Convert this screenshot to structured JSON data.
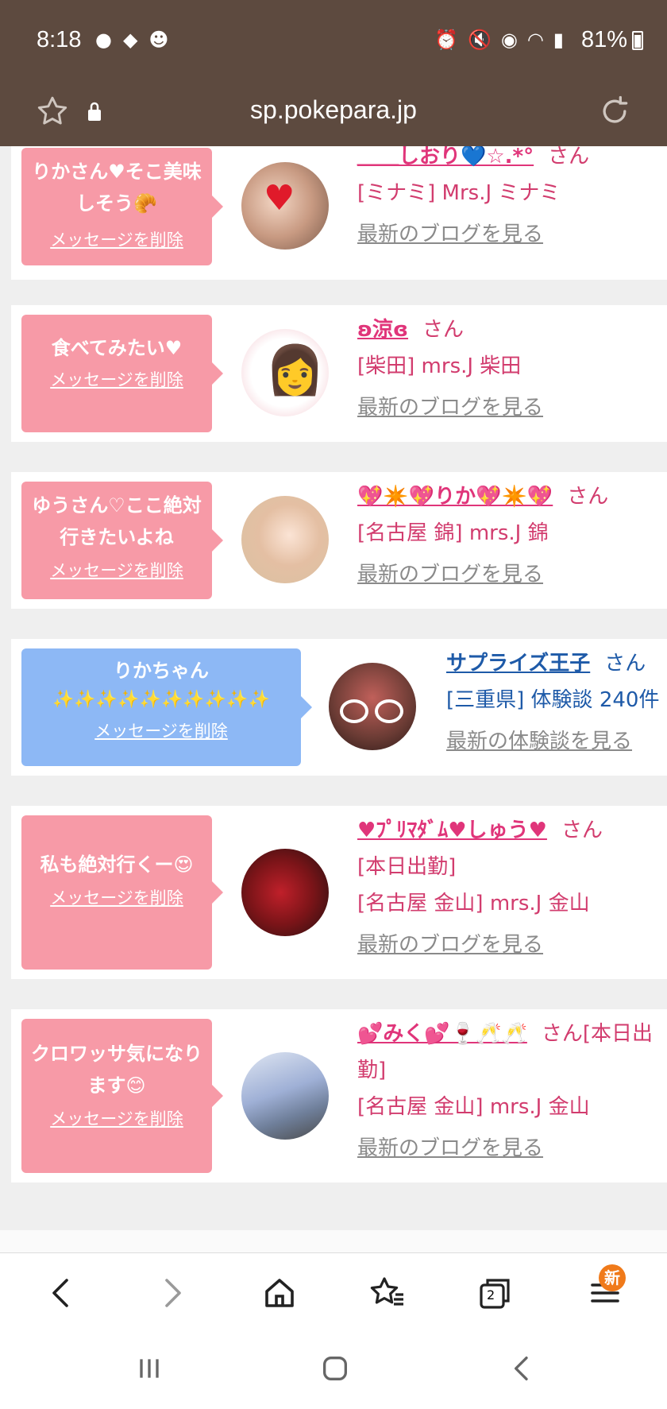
{
  "status_bar": {
    "time": "8:18",
    "battery": "81%"
  },
  "browser": {
    "url": "sp.pokepara.jp"
  },
  "cards": [
    {
      "message": "りかさん♥そこ美味しそう🥐",
      "delete_label": "メッセージを削除",
      "name": "＿＿しおり💙☆.*°",
      "suffix": "さん",
      "line2": "[ミナミ] Mrs.J ミナミ",
      "line3": "",
      "link": "最新のブログを見る",
      "style": "pink"
    },
    {
      "message": "食べてみたい♥",
      "delete_label": "メッセージを削除",
      "name": "ʚ涼ɞ",
      "suffix": "さん",
      "line2": "[柴田] mrs.J 柴田",
      "line3": "",
      "link": "最新のブログを見る",
      "style": "pink"
    },
    {
      "message": "ゆうさん♡ここ絶対行きたいよね",
      "delete_label": "メッセージを削除",
      "name": "💖✴️💖りか💖✴️💖",
      "suffix": "さん",
      "line2": "[名古屋 錦] mrs.J 錦",
      "line3": "",
      "link": "最新のブログを見る",
      "style": "pink"
    },
    {
      "message": "りかちゃん",
      "message2": "✨✨✨✨✨✨✨✨✨✨",
      "delete_label": "メッセージを削除",
      "name": "サプライズ王子",
      "suffix": "さん",
      "line2": "[三重県] 体験談 240件",
      "line3": "",
      "link": "最新の体験談を見る",
      "style": "blue"
    },
    {
      "message": "私も絶対行くー😍",
      "delete_label": "メッセージを削除",
      "name": "♥ﾌﾟﾘﾏﾀﾞﾑ♥しゅう♥",
      "suffix": "さん",
      "line2": "[本日出勤]",
      "line3": "[名古屋 金山] mrs.J 金山",
      "link": "最新のブログを見る",
      "style": "pink"
    },
    {
      "message": "クロワッサ気になります😊",
      "delete_label": "メッセージを削除",
      "name": "💕みく💕🍷🥂🥂",
      "suffix": "さん[本日出勤]",
      "line2": "[名古屋 金山] mrs.J 金山",
      "line3": "",
      "link": "最新のブログを見る",
      "style": "pink"
    }
  ],
  "bottom_nav": {
    "tabs_count": "2",
    "menu_badge": "新"
  },
  "colors": {
    "header": "#5d4a3f",
    "pink_bubble": "#f79aa7",
    "blue_bubble": "#8db8f5",
    "name_pink": "#e0357a",
    "name_blue": "#1e5aa8"
  }
}
